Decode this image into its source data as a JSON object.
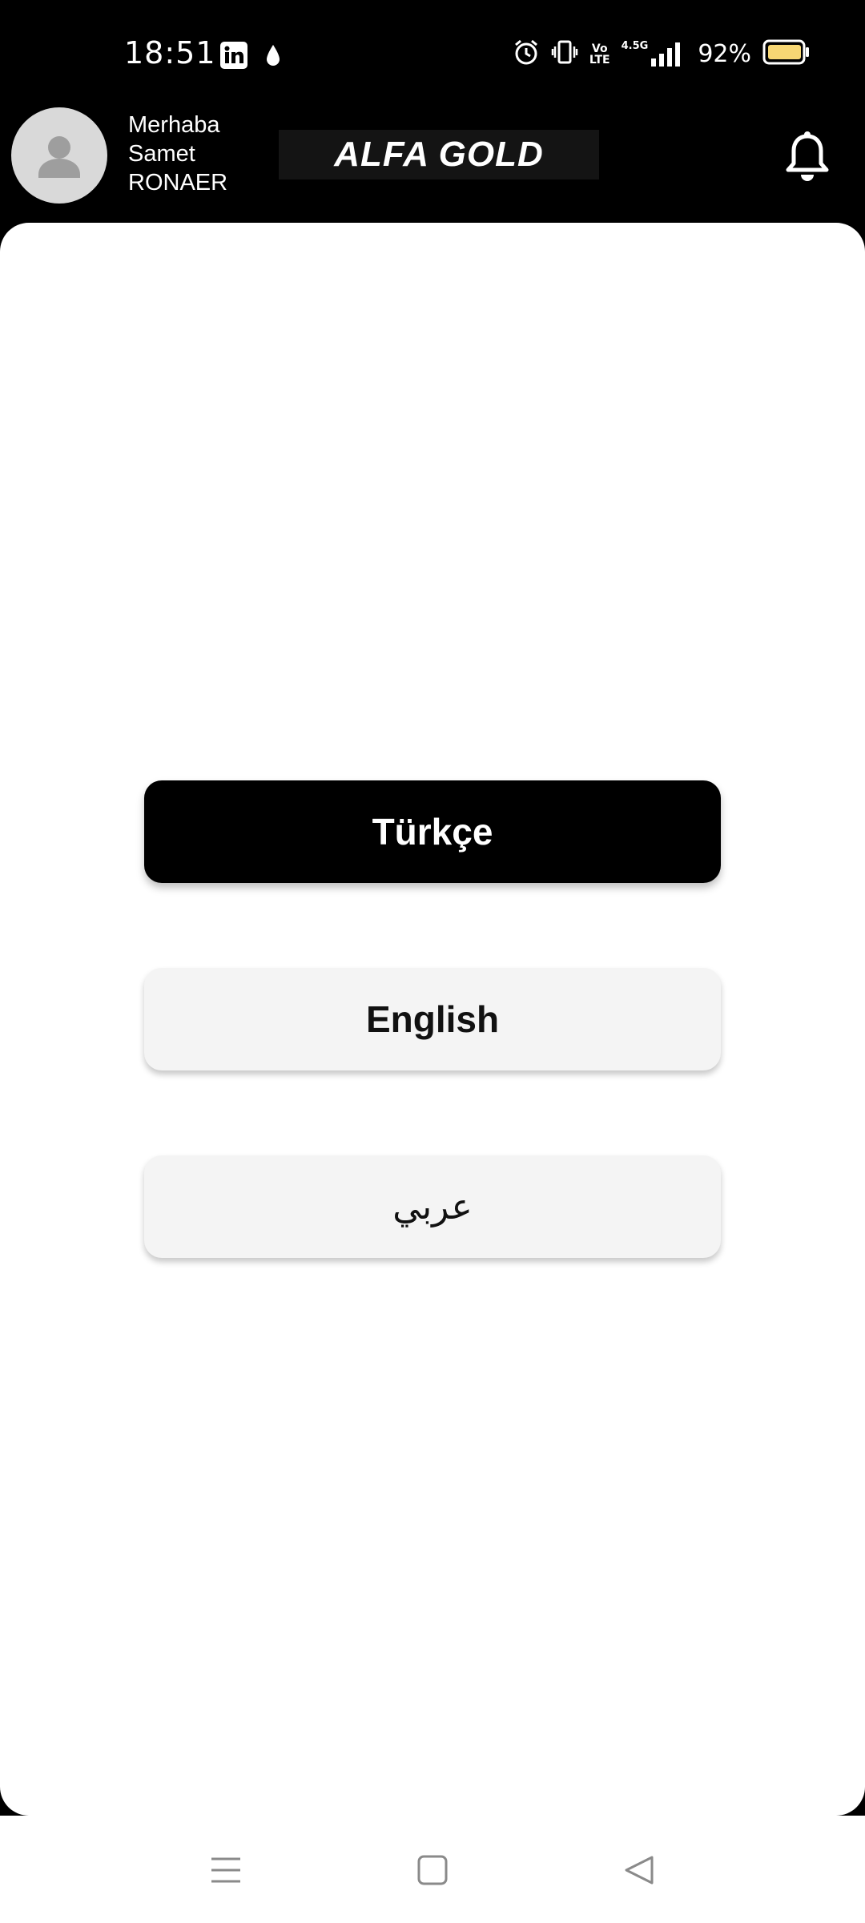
{
  "status_bar": {
    "time": "18:51",
    "battery": "92%",
    "network": "4.5G",
    "volte_top": "Vo",
    "volte_bottom": "LTE"
  },
  "header": {
    "greeting_line1": "Merhaba",
    "greeting_line2": "Samet",
    "greeting_line3": "RONAER",
    "logo_text": "ALFA GOLD"
  },
  "languages": {
    "turkish": "Türkçe",
    "english": "English",
    "arabic": "عربي",
    "selected": "turkish"
  },
  "colors": {
    "selected_bg": "#000000",
    "button_bg": "#f4f4f4",
    "battery_fill": "#f7d774"
  }
}
